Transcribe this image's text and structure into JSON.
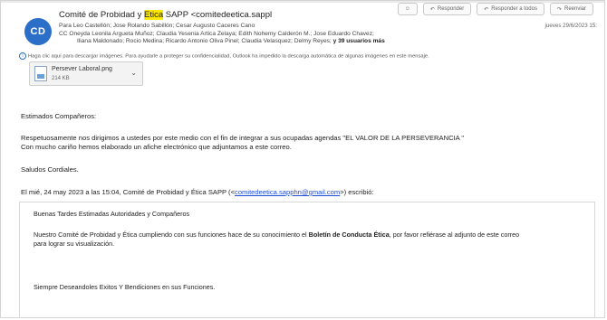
{
  "header": {
    "avatar_initials": "CD",
    "sender_prefix": "Comité de Probidad y ",
    "sender_highlight": "Etica",
    "sender_suffix": " SAPP <comitedeetica.sappl",
    "para": "Para   Leo Castellón; Jose Rolando Sabillón; Cesar Augusto Caceres Cano",
    "cc_line1": "CC   Oneyda Leonila Argueta Muñoz; Claudia Yesenia Artica Zelaya; Edith Nohemy  Calderón  M.; Jose Eduardo Chavez;",
    "cc_line2_prefix": "Iliana Maldonado; Rocio Medina; Ricardo Antonio  Oliva  Pinel; Claudia Velasquez; Delmy Reyes; ",
    "cc_line2_bold": "y 39 usuarios más",
    "date": "jueves 29/6/2023 15:",
    "actions": {
      "reply": "Responder",
      "reply_all": "Responder a todos",
      "forward": "Reenviar"
    }
  },
  "info_bar": "Haga clic aquí para descargar imágenes. Para ayudarle a proteger su confidencialidad, Outlook ha impedido la descarga automática de algunas imágenes en este mensaje.",
  "attachment": {
    "name": "Persever Laboral.png",
    "size": "214 KB"
  },
  "message": {
    "greeting": "Estimados Compañeros:",
    "line1": "Respetuosamente nos dirigimos a ustedes por este medio con el fin de  integrar a sus ocupadas agendas \"EL VALOR DE LA PERSEVERANCIA \"",
    "line2": "Con mucho cariño hemos elaborado un afiche electrónico que adjuntamos a este correo.",
    "closing": "Saludos Cordiales.",
    "quote_header_prefix": "El mié, 24 may 2023 a las 15:04, Comité de Probidad y Ética SAPP (<",
    "quote_header_link": "comitedeetica.sapphn@gmail.com",
    "quote_header_suffix": ">) escribió:"
  },
  "quoted": {
    "greeting": "Buenas Tardes Estimadas Autoridades y Compañeros",
    "line1_prefix": "Nuestro Comité de Probidad y Ética cumpliendo con sus funciones hace de su conocimiento el ",
    "line1_bold": "Boletín de Conducta Ética",
    "line1_suffix": ", por favor refiérase al adjunto de este correo",
    "line2": "para lograr su visualización.",
    "closing": "Siempre Deseandoles Exitos Y Bendiciones en sus Funciones."
  },
  "colors": {
    "avatar": "#2c6fc9",
    "highlight": "#ffe800",
    "link": "#1f4fd6"
  }
}
